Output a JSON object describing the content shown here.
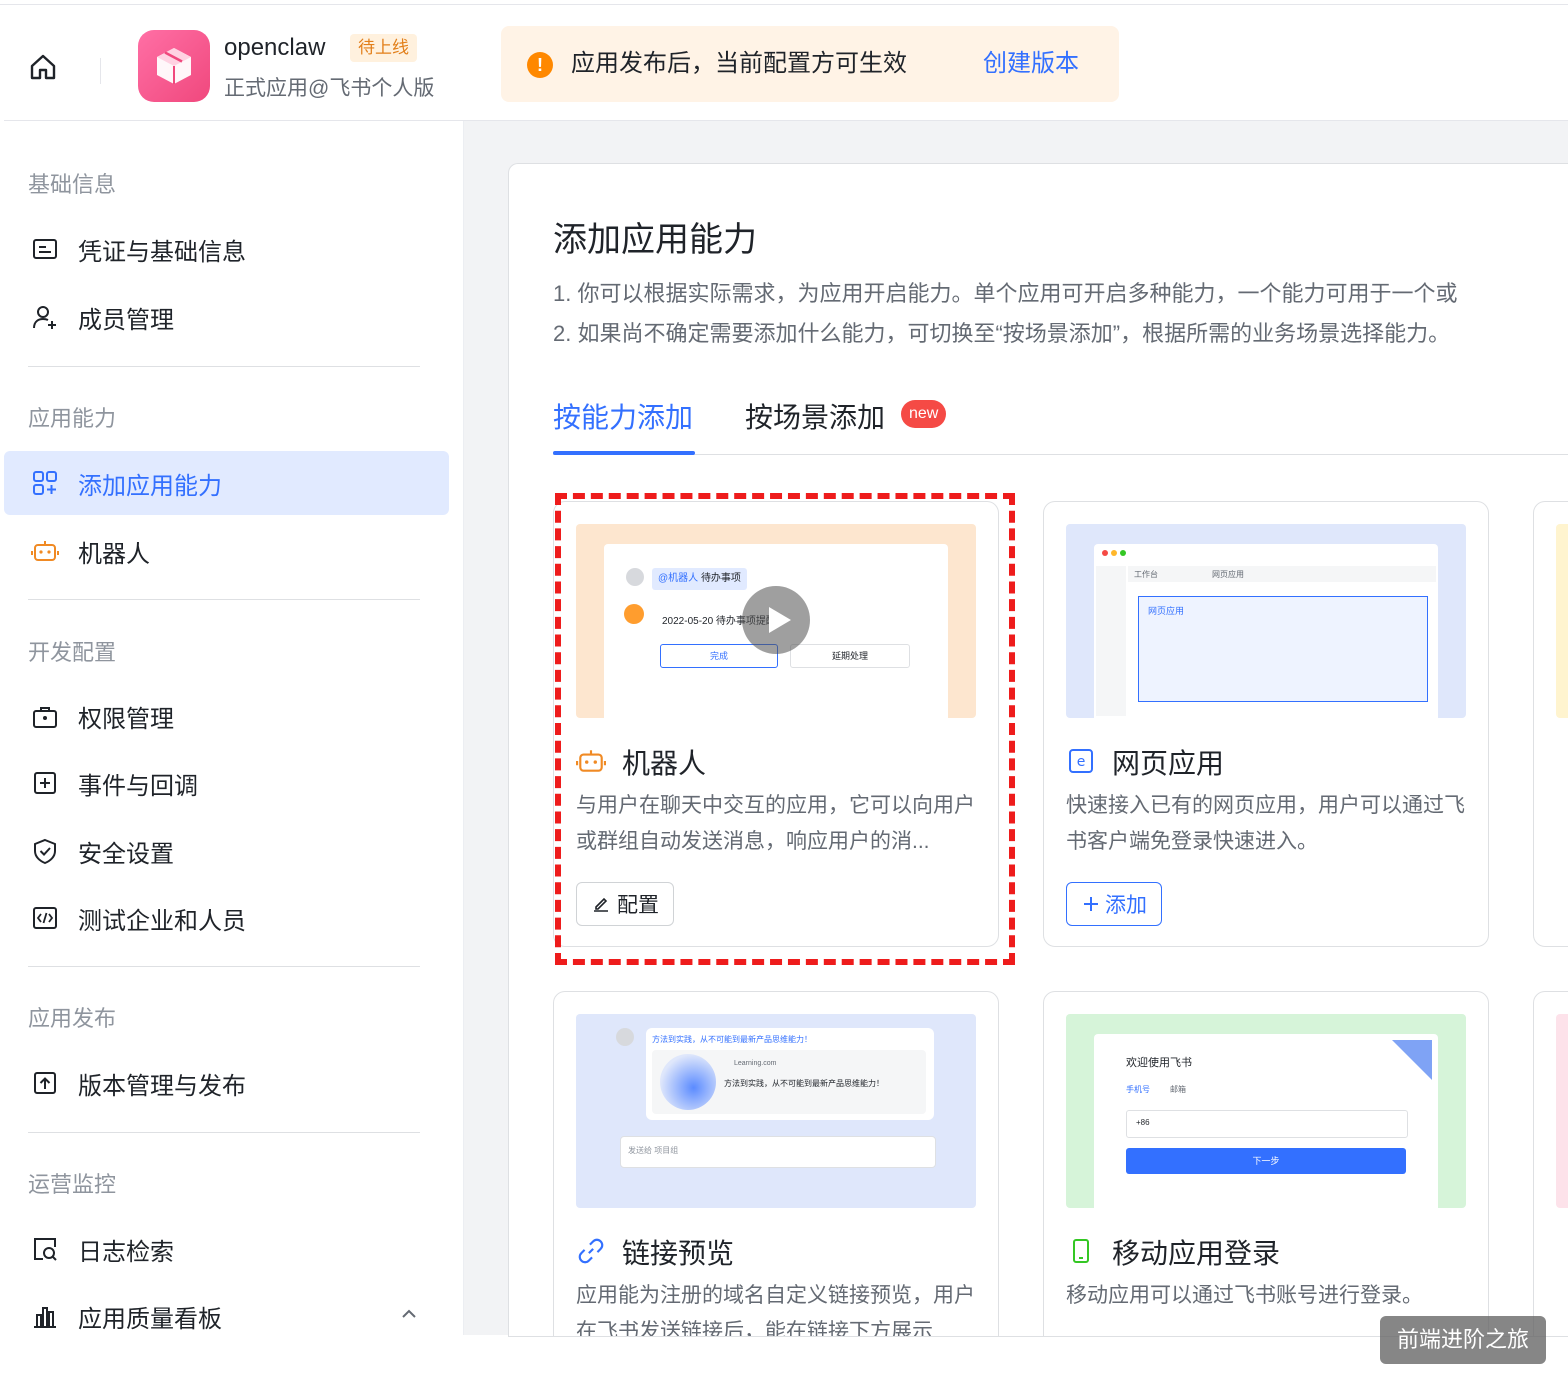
{
  "header": {
    "app_name": "openclaw",
    "app_status": "待上线",
    "app_subtitle": "正式应用@飞书个人版",
    "notice_text": "应用发布后，当前配置方可生效",
    "notice_link": "创建版本"
  },
  "sidebar": {
    "sections": [
      {
        "title": "基础信息",
        "items": [
          {
            "label": "凭证与基础信息"
          },
          {
            "label": "成员管理"
          }
        ]
      },
      {
        "title": "应用能力",
        "items": [
          {
            "label": "添加应用能力",
            "active": true
          },
          {
            "label": "机器人"
          }
        ]
      },
      {
        "title": "开发配置",
        "items": [
          {
            "label": "权限管理"
          },
          {
            "label": "事件与回调"
          },
          {
            "label": "安全设置"
          },
          {
            "label": "测试企业和人员"
          }
        ]
      },
      {
        "title": "应用发布",
        "items": [
          {
            "label": "版本管理与发布"
          }
        ]
      },
      {
        "title": "运营监控",
        "items": [
          {
            "label": "日志检索"
          },
          {
            "label": "应用质量看板"
          }
        ]
      }
    ]
  },
  "main": {
    "title": "添加应用能力",
    "desc1": "1. 你可以根据实际需求，为应用开启能力。单个应用可开启多种能力，一个能力可用于一个或",
    "desc2": "2. 如果尚不确定需要添加什么能力，可切换至“按场景添加”，根据所需的业务场景选择能力。",
    "tabs": [
      {
        "label": "按能力添加",
        "active": true
      },
      {
        "label": "按场景添加",
        "badge": "new"
      }
    ],
    "cards": [
      {
        "title": "机器人",
        "desc": "与用户在聊天中交互的应用，它可以向用户或群组自动发送消息，响应用户的消...",
        "button": "配置",
        "button_icon": "edit-icon",
        "thumb": {
          "tag": "@机器人",
          "tag2": "待办事项",
          "date_text": "2022-05-20 待办事项提醒",
          "btn1": "完成",
          "btn2": "延期处理"
        }
      },
      {
        "title": "网页应用",
        "desc": "快速接入已有的网页应用，用户可以通过飞书客户端免登录快速进入。",
        "button": "添加",
        "button_icon": "plus-icon",
        "thumb": {
          "tab1": "工作台",
          "tab2": "网页应用",
          "panel_label": "网页应用"
        }
      },
      {
        "title": "链接预览",
        "desc": "应用能为注册的域名自定义链接预览，用户在飞书发送链接后，能在链接下方展示",
        "thumb": {
          "link_text": "方法到实践，从不可能到最新产品思维能力！",
          "domain": "Learning.com",
          "preview_text": "方法到实践，从不可能到最新产品思维能力！",
          "input_placeholder": "发送给 项目组"
        }
      },
      {
        "title": "移动应用登录",
        "desc": "移动应用可以通过飞书账号进行登录。",
        "thumb": {
          "welcome": "欢迎使用飞书",
          "tab_phone": "手机号",
          "tab_email": "邮箱",
          "country_code": "+86",
          "next_btn": "下一步"
        }
      }
    ]
  },
  "watermark": "前端进阶之旅",
  "colors": {
    "primary": "#3370ff",
    "active_bg": "#e1eaff",
    "warning": "#ff8800",
    "highlight_dash": "#ee1c1c",
    "new_badge": "#f54a45"
  }
}
